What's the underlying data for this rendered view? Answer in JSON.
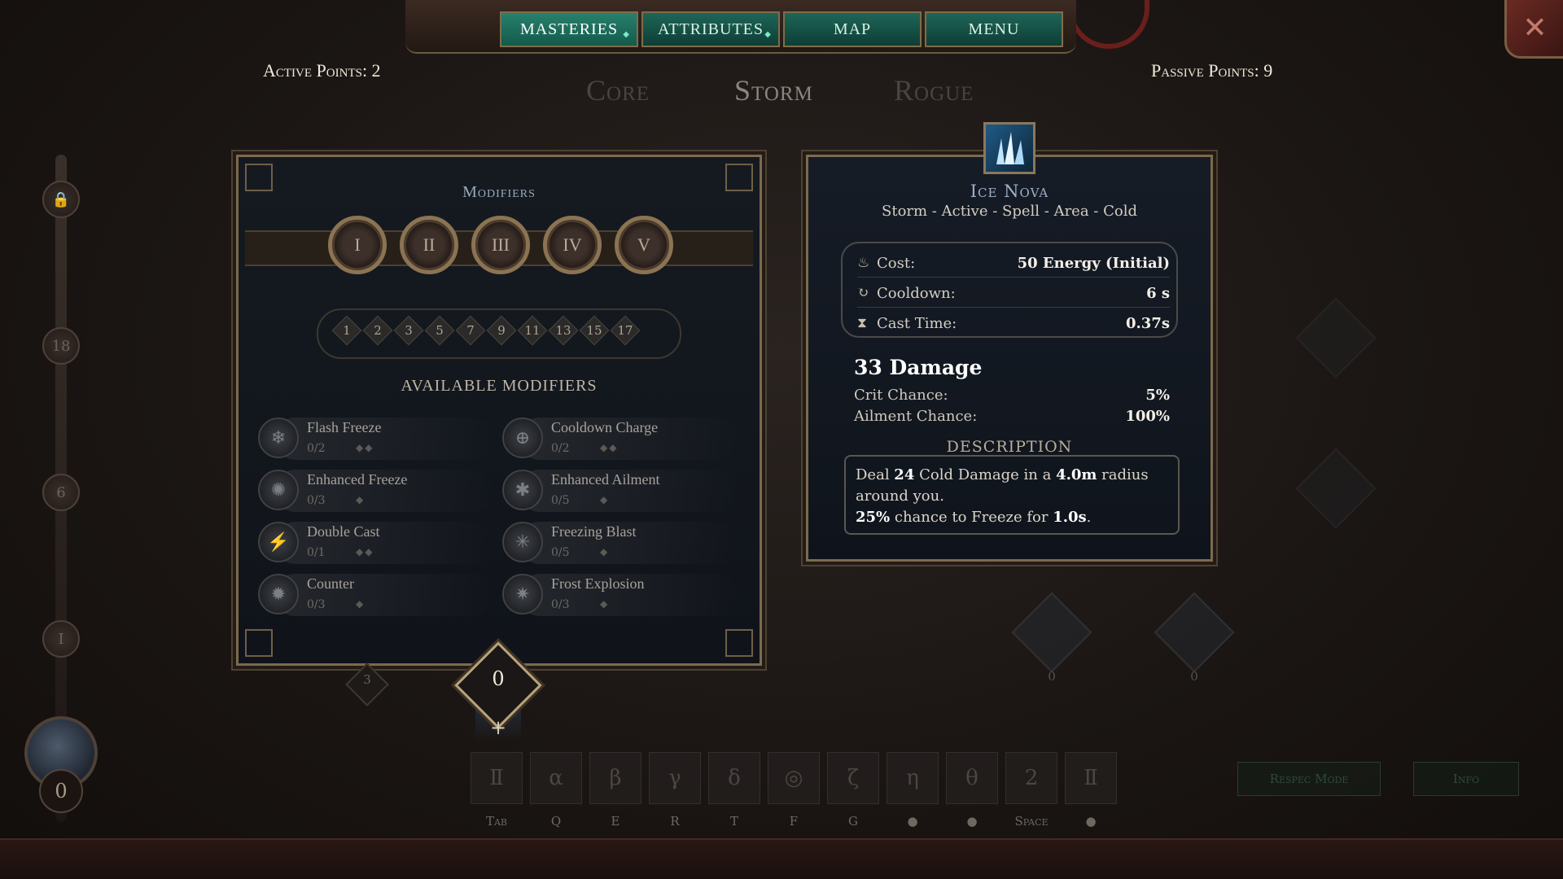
{
  "nav": {
    "tabs": [
      {
        "label": "Masteries",
        "active": true,
        "has_dot": true
      },
      {
        "label": "Attributes",
        "active": false,
        "has_dot": true
      },
      {
        "label": "Map",
        "active": false,
        "has_dot": false
      },
      {
        "label": "Menu",
        "active": false,
        "has_dot": false
      }
    ]
  },
  "points": {
    "active": "Active Points: 2",
    "passive": "Passive Points: 9"
  },
  "mastery_tabs": [
    {
      "label": "Core",
      "active": false
    },
    {
      "label": "Storm",
      "active": true
    },
    {
      "label": "Rogue",
      "active": false
    }
  ],
  "track": {
    "nodes": [
      "",
      "18",
      "6",
      "I"
    ],
    "orb_count": "0"
  },
  "modifiers": {
    "title": "Modifiers",
    "tiers": [
      "I",
      "II",
      "III",
      "IV",
      "V"
    ],
    "levels": [
      "1",
      "2",
      "3",
      "5",
      "7",
      "9",
      "11",
      "13",
      "15",
      "17"
    ],
    "available_title": "AVAILABLE MODIFIERS",
    "items": [
      {
        "name": "Flash Freeze",
        "count": "0/2",
        "dots": "◆◆",
        "icon": "snowflake-icon"
      },
      {
        "name": "Cooldown Charge",
        "count": "0/2",
        "dots": "◆◆",
        "icon": "cooldown-icon"
      },
      {
        "name": "Enhanced Freeze",
        "count": "0/3",
        "dots": "◆",
        "icon": "frost-burst-icon"
      },
      {
        "name": "Enhanced Ailment",
        "count": "0/5",
        "dots": "◆",
        "icon": "ailment-icon"
      },
      {
        "name": "Double Cast",
        "count": "0/1",
        "dots": "◆◆",
        "icon": "double-cast-icon"
      },
      {
        "name": "Freezing Blast",
        "count": "0/5",
        "dots": "◆",
        "icon": "blast-icon"
      },
      {
        "name": "Counter",
        "count": "0/3",
        "dots": "◆",
        "icon": "counter-icon"
      },
      {
        "name": "Frost Explosion",
        "count": "0/3",
        "dots": "◆",
        "icon": "explosion-icon"
      }
    ],
    "points_value": "0",
    "small_node": "3",
    "plus": "+"
  },
  "skill": {
    "name": "Ice Nova",
    "tags": "Storm - Active - Spell - Area - Cold",
    "stats": [
      {
        "label": "Cost:",
        "value": "50 Energy (Initial)",
        "icon": "energy-icon"
      },
      {
        "label": "Cooldown:",
        "value": "6 s",
        "icon": "cooldown-icon"
      },
      {
        "label": "Cast Time:",
        "value": "0.37s",
        "icon": "hourglass-icon"
      }
    ],
    "damage": "33 Damage",
    "crit_label": "Crit Chance:",
    "crit_value": "5%",
    "ailment_label": "Ailment Chance:",
    "ailment_value": "100%",
    "description_title": "DESCRIPTION",
    "description": {
      "p1_a": "Deal ",
      "p1_b": "24",
      "p1_c": " Cold Damage in a ",
      "p1_d": "4.0m",
      "p1_e": " radius around you.",
      "p2_a": "25%",
      "p2_b": " chance to Freeze for ",
      "p2_c": "1.0s",
      "p2_d": "."
    }
  },
  "deco": {
    "values": [
      "0",
      "0"
    ]
  },
  "hotbar": {
    "slots": [
      {
        "glyph": "Ⅱ",
        "key": "Tab"
      },
      {
        "glyph": "α",
        "key": "Q"
      },
      {
        "glyph": "β",
        "key": "E"
      },
      {
        "glyph": "γ",
        "key": "R"
      },
      {
        "glyph": "δ",
        "key": "T"
      },
      {
        "glyph": "◎",
        "key": "F"
      },
      {
        "glyph": "ζ",
        "key": "G"
      },
      {
        "glyph": "η",
        "key": "●"
      },
      {
        "glyph": "θ",
        "key": "●"
      },
      {
        "glyph": "2",
        "key": "Space"
      },
      {
        "glyph": "Ⅱ",
        "key": "●"
      }
    ]
  },
  "buttons": {
    "respec": "Respec Mode",
    "info": "Info",
    "close": "✕"
  },
  "colors": {
    "accent_teal": "#1e6558",
    "frame_gold": "#7c6a4c",
    "panel_bg": "#151a21"
  }
}
